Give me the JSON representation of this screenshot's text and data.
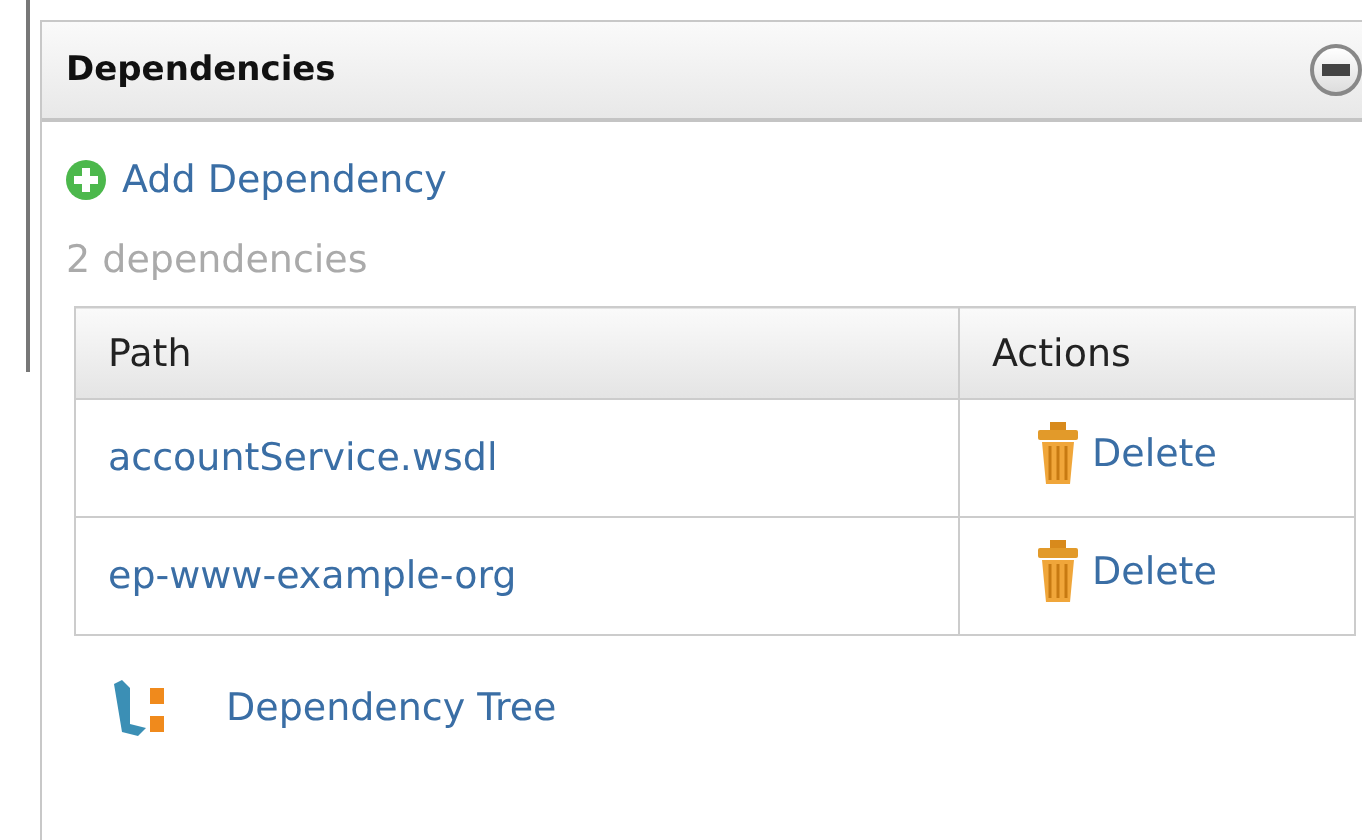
{
  "panel": {
    "title": "Dependencies",
    "expanded": true
  },
  "add_link": "Add Dependency",
  "count": "2 dependencies",
  "table": {
    "columns": [
      "Path",
      "Actions"
    ],
    "rows": [
      {
        "path": "accountService.wsdl",
        "action": "Delete"
      },
      {
        "path": "ep-www-example-org",
        "action": "Delete"
      }
    ]
  },
  "tree_link": "Dependency Tree"
}
